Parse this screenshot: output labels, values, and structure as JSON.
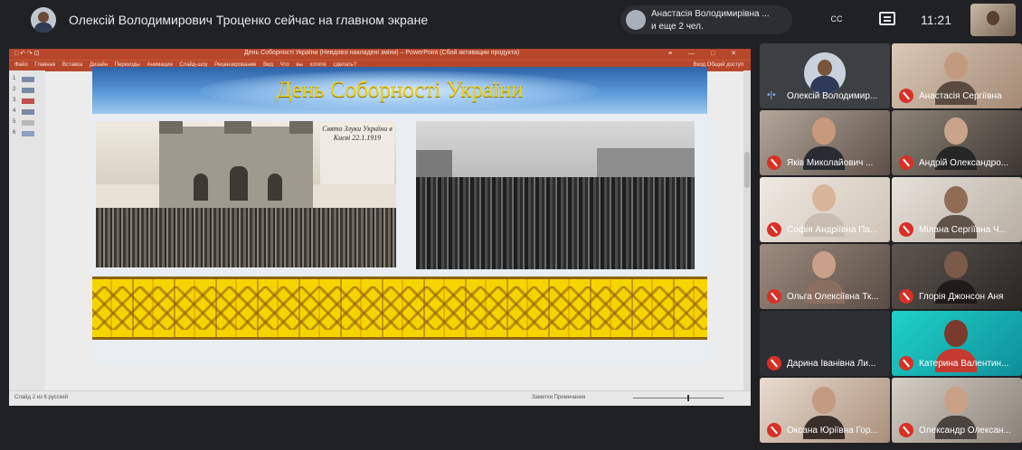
{
  "meet": {
    "presenting_text": "Олексій Володимирович Троценко сейчас на главном экране",
    "others_name": "Анастасія Володимирівна ...",
    "others_more": "и еще 2 чел.",
    "captions_label": "CC",
    "time": "11:21"
  },
  "ppt": {
    "title_text": "День Соборності України (Невдовзі накладені зміни) – PowerPoint (Сбой активации продукта)",
    "title_icons": "□ ↶ ↷ ⊡",
    "window_controls": "≡ — □ ✕",
    "ribbon_tabs": "Файл Главная Вставка Дизайн Переходы Анимация Слайд-шоу Рецензирование Вид Что вы хотите сделать?",
    "ribbon_right": "Вход  Общий доступ",
    "status_left": "Слайд 2 из 6   русский",
    "status_right": "Заметки  Примечания",
    "thumbnails": [
      "1",
      "2",
      "3",
      "4",
      "5",
      "6"
    ]
  },
  "slide": {
    "title": "День Соборності України",
    "photo_note": "Свято Злуки України в Києві 22.1.1919"
  },
  "participants": [
    {
      "name": "Олексій Володимир...",
      "muted": false
    },
    {
      "name": "Анастасія Сергіївна",
      "muted": true
    },
    {
      "name": "Яків Миколайович ...",
      "muted": true
    },
    {
      "name": "Андрій Олександро...",
      "muted": true
    },
    {
      "name": "Софія Андріївна Па...",
      "muted": true
    },
    {
      "name": "Мілана Сергіївна Ч...",
      "muted": true
    },
    {
      "name": "Ольга Олексіївна Тк...",
      "muted": true
    },
    {
      "name": "Глорія Джонсон Аня",
      "muted": true
    },
    {
      "name": "Дарина Іванівна Ли...",
      "muted": true
    },
    {
      "name": "Катерина Валентин...",
      "muted": true
    },
    {
      "name": "Оксана Юріївна Гор...",
      "muted": true
    },
    {
      "name": "Олександр Олексан...",
      "muted": true
    }
  ],
  "colors": {
    "meet_bg": "#202124",
    "ppt_accent": "#b7472a",
    "mute_red": "#d93025",
    "title_yellow": "#f2d21b"
  }
}
